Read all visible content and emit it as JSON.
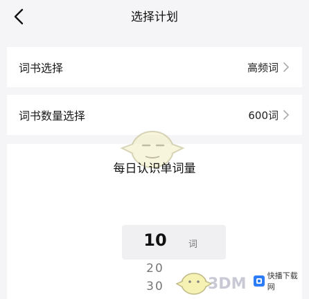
{
  "header": {
    "title": "选择计划"
  },
  "settings": [
    {
      "label": "词书选择",
      "value": "高频词"
    },
    {
      "label": "词书数量选择",
      "value": "600词"
    }
  ],
  "daily": {
    "title": "每日认识单词量",
    "picker": {
      "selected": "10",
      "unit": "词",
      "next": [
        "20",
        "30"
      ]
    }
  },
  "watermark": {
    "text": "3DM",
    "badge": "快播下载网"
  },
  "colors": {
    "background": "#f5f5f7",
    "card": "#ffffff",
    "badge": "#2b7cf6"
  }
}
